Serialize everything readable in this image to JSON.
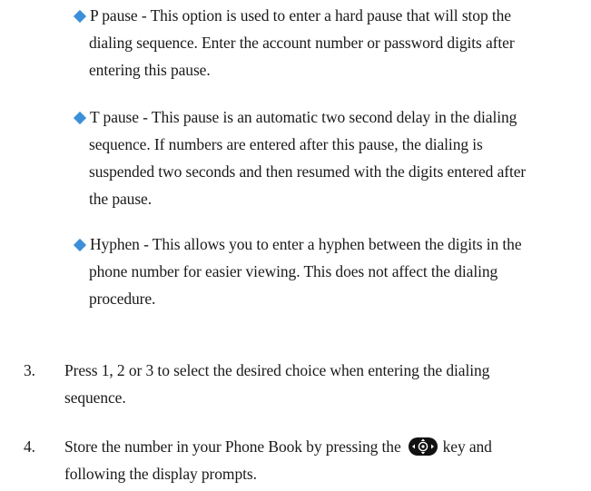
{
  "bullets": [
    {
      "icon": "diamond-bullet-icon",
      "color": "#3c8fd9",
      "lines": [
        "P pause - This option is used to enter a hard pause that will stop the",
        "dialing sequence. Enter the account number or password digits after",
        "entering this pause."
      ]
    },
    {
      "icon": "diamond-bullet-icon",
      "color": "#3c8fd9",
      "lines": [
        "T pause - This pause is an automatic two second delay in the dialing",
        "sequence. If numbers are entered after this pause, the dialing is",
        "suspended two seconds and then resumed with the digits entered after",
        "the pause."
      ]
    },
    {
      "icon": "diamond-bullet-icon",
      "color": "#3c8fd9",
      "lines": [
        "Hyphen - This allows you to enter a hyphen between the digits in the",
        "phone number for easier viewing. This does not affect the dialing",
        "procedure."
      ]
    }
  ],
  "steps": [
    {
      "number": "3.",
      "lines": [
        "Press 1, 2 or 3 to select the desired choice when entering the dialing",
        "sequence."
      ]
    },
    {
      "number": "4.",
      "line1_before_icon": "Store the number in your Phone Book by pressing the",
      "icon": "navigation-key-icon",
      "line1_after_icon": "key and",
      "line2": "following the display prompts."
    }
  ]
}
